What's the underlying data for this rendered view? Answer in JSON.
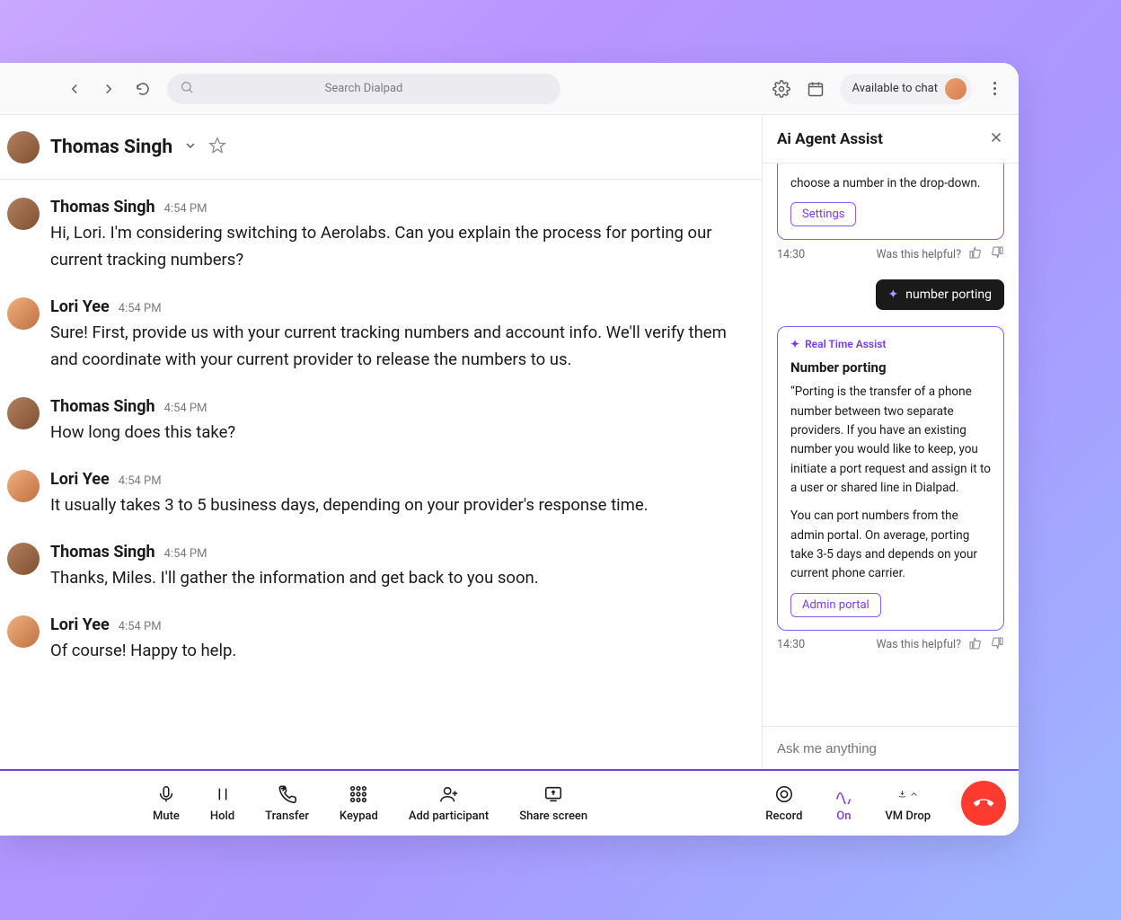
{
  "header": {
    "search_placeholder": "Search Dialpad",
    "status_label": "Available to chat"
  },
  "contact": {
    "name": "Thomas Singh"
  },
  "messages": [
    {
      "author": "Thomas Singh",
      "avatar": "thomas",
      "time": "4:54 PM",
      "text": "Hi, Lori. I'm considering switching to Aerolabs. Can you explain the process for porting our current tracking numbers?"
    },
    {
      "author": "Lori Yee",
      "avatar": "lori",
      "time": "4:54 PM",
      "text": "Sure! First, provide us with your current tracking numbers and account info. We'll verify them and coordinate with your current provider to release the numbers to us."
    },
    {
      "author": "Thomas Singh",
      "avatar": "thomas",
      "time": "4:54 PM",
      "text": "How long does this take?"
    },
    {
      "author": "Lori Yee",
      "avatar": "lori",
      "time": "4:54 PM",
      "text": "It usually takes 3 to 5 business days, depending on your provider's response time."
    },
    {
      "author": "Thomas Singh",
      "avatar": "thomas",
      "time": "4:54 PM",
      "text": "Thanks, Miles. I'll gather the information and get back to you soon."
    },
    {
      "author": "Lori Yee",
      "avatar": "lori",
      "time": "4:54 PM",
      "text": "Of course! Happy to help."
    }
  ],
  "assist": {
    "panel_title": "Ai Agent Assist",
    "card1": {
      "text_tail": "choose a number in the drop-down.",
      "button": "Settings",
      "time": "14:30",
      "helpful_label": "Was this helpful?"
    },
    "user_query": "number porting",
    "card2": {
      "rt_label": "Real Time Assist",
      "title": "Number porting",
      "para1": "“Porting is the transfer of a phone number between two separate providers. If you have an existing number you would like to keep, you initiate a port request and assign it to a user or shared line in Dialpad.",
      "para2": "You can port numbers from the admin portal. On average, porting take 3-5 days and depends on your current phone carrier.",
      "button": "Admin portal",
      "time": "14:30",
      "helpful_label": "Was this helpful?"
    },
    "input_placeholder": "Ask me anything"
  },
  "callbar": {
    "mute": "Mute",
    "hold": "Hold",
    "transfer": "Transfer",
    "keypad": "Keypad",
    "add": "Add participant",
    "share": "Share screen",
    "record": "Record",
    "on": "On",
    "vm": "VM Drop"
  }
}
